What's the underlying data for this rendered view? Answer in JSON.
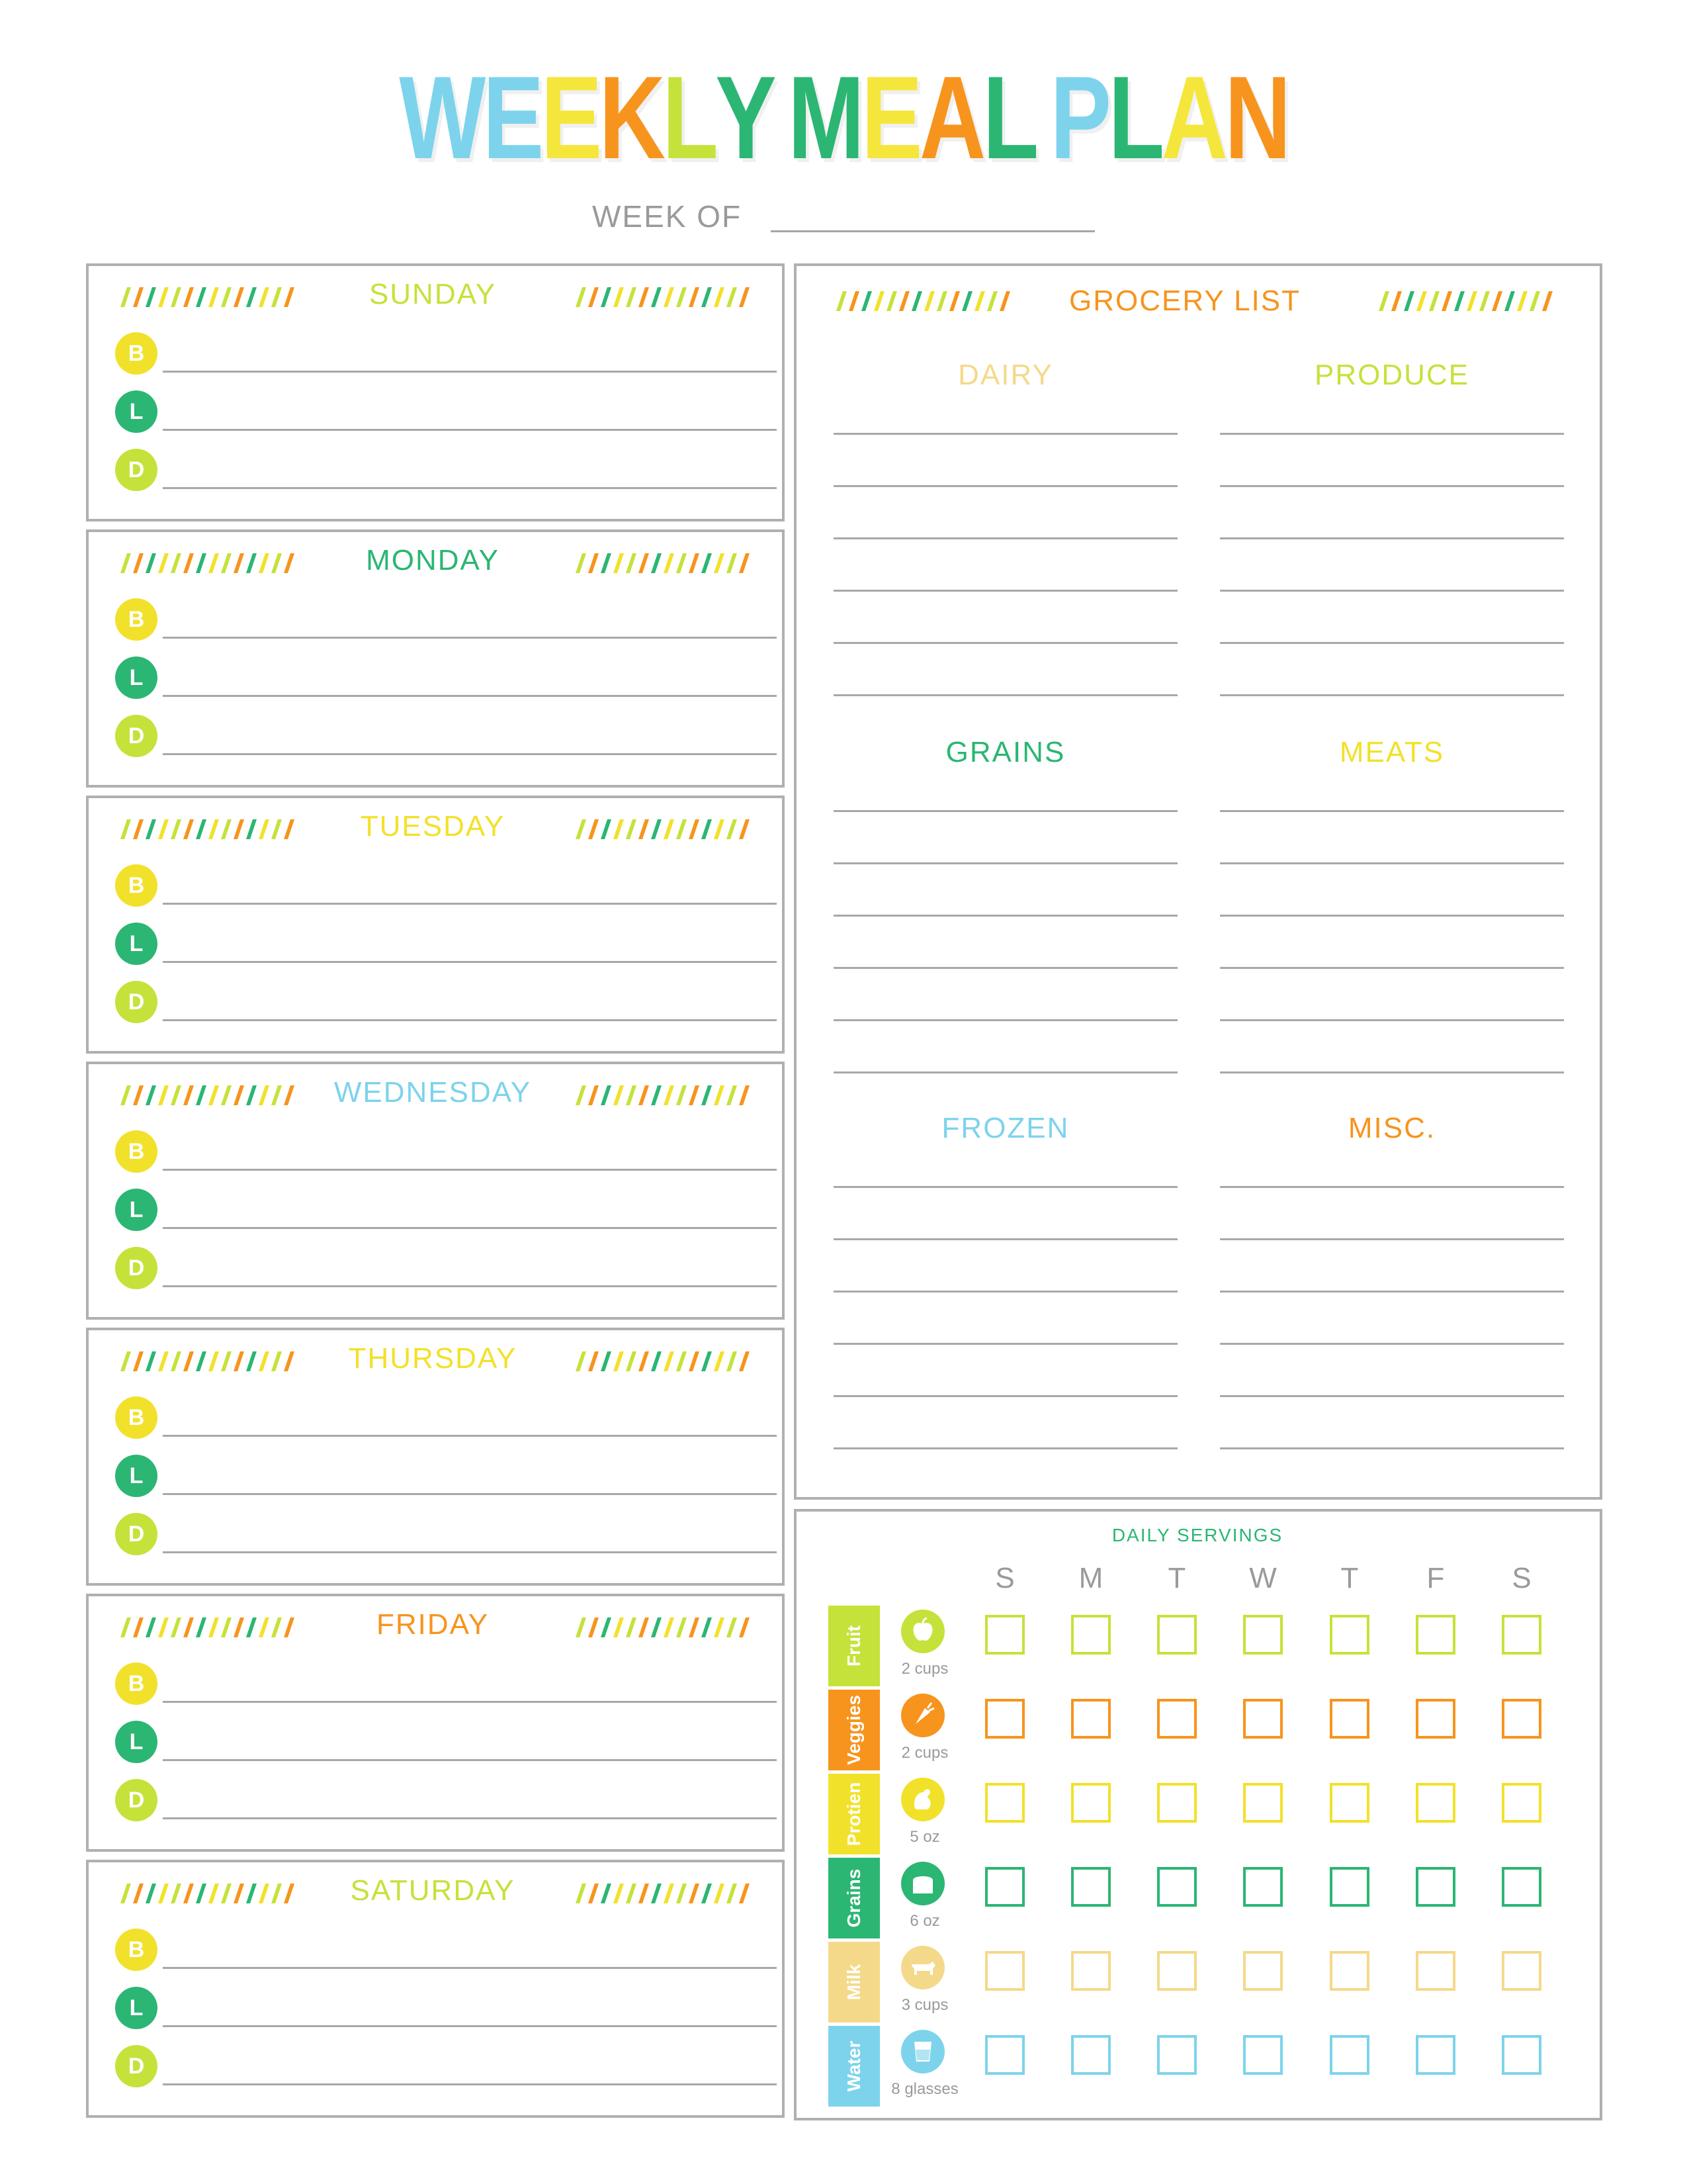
{
  "title": {
    "letters": [
      {
        "ch": "W",
        "color": "#7dd3ec"
      },
      {
        "ch": "E",
        "color": "#7dd3ec"
      },
      {
        "ch": "E",
        "color": "#f5e63b"
      },
      {
        "ch": "K",
        "color": "#f7941d"
      },
      {
        "ch": "L",
        "color": "#c5e23a"
      },
      {
        "ch": "Y",
        "color": "#2bb673"
      },
      {
        "ch": " ",
        "color": "#ffffff"
      },
      {
        "ch": "M",
        "color": "#2bb673"
      },
      {
        "ch": "E",
        "color": "#f5e63b"
      },
      {
        "ch": "A",
        "color": "#f7941d"
      },
      {
        "ch": "L",
        "color": "#2bb673"
      },
      {
        "ch": " ",
        "color": "#ffffff"
      },
      {
        "ch": "P",
        "color": "#7dd3ec"
      },
      {
        "ch": "L",
        "color": "#2bb673"
      },
      {
        "ch": "A",
        "color": "#f5e63b"
      },
      {
        "ch": "N",
        "color": "#f7941d"
      }
    ]
  },
  "week_of_label": "WEEK OF",
  "meals": {
    "b": "B",
    "l": "L",
    "d": "D"
  },
  "meal_colors": {
    "b": "#f2e12a",
    "l": "#2bb673",
    "d": "#c5e23a"
  },
  "days": [
    {
      "name": "SUNDAY",
      "color": "#c5e23a"
    },
    {
      "name": "MONDAY",
      "color": "#2bb673"
    },
    {
      "name": "TUESDAY",
      "color": "#f2e12a"
    },
    {
      "name": "WEDNESDAY",
      "color": "#7dd3ec"
    },
    {
      "name": "THURSDAY",
      "color": "#f2e12a"
    },
    {
      "name": "FRIDAY",
      "color": "#f7941d"
    },
    {
      "name": "SATURDAY",
      "color": "#c5e23a"
    }
  ],
  "grocery": {
    "title": "GROCERY LIST",
    "title_color": "#f7941d",
    "sections": [
      {
        "name": "DAIRY",
        "color": "#f5d98a"
      },
      {
        "name": "PRODUCE",
        "color": "#c5e23a"
      },
      {
        "name": "GRAINS",
        "color": "#2bb673"
      },
      {
        "name": "MEATS",
        "color": "#f2e12a"
      },
      {
        "name": "FROZEN",
        "color": "#7dd3ec"
      },
      {
        "name": "MISC.",
        "color": "#f7941d"
      }
    ]
  },
  "servings": {
    "title": "DAILY SERVINGS",
    "days": [
      "S",
      "M",
      "T",
      "W",
      "T",
      "F",
      "S"
    ],
    "categories": [
      {
        "label": "Fruit",
        "amount": "2 cups",
        "color": "#c5e23a",
        "icon": "apple-icon"
      },
      {
        "label": "Veggies",
        "amount": "2 cups",
        "color": "#f7941d",
        "icon": "carrot-icon"
      },
      {
        "label": "Protien",
        "amount": "5 oz",
        "color": "#f2e12a",
        "icon": "chicken-icon"
      },
      {
        "label": "Grains",
        "amount": "6 oz",
        "color": "#2bb673",
        "icon": "bread-icon"
      },
      {
        "label": "Milk",
        "amount": "3 cups",
        "color": "#f5d98a",
        "icon": "cow-icon"
      },
      {
        "label": "Water",
        "amount": "8 glasses",
        "color": "#7dd3ec",
        "icon": "glass-icon"
      }
    ]
  }
}
